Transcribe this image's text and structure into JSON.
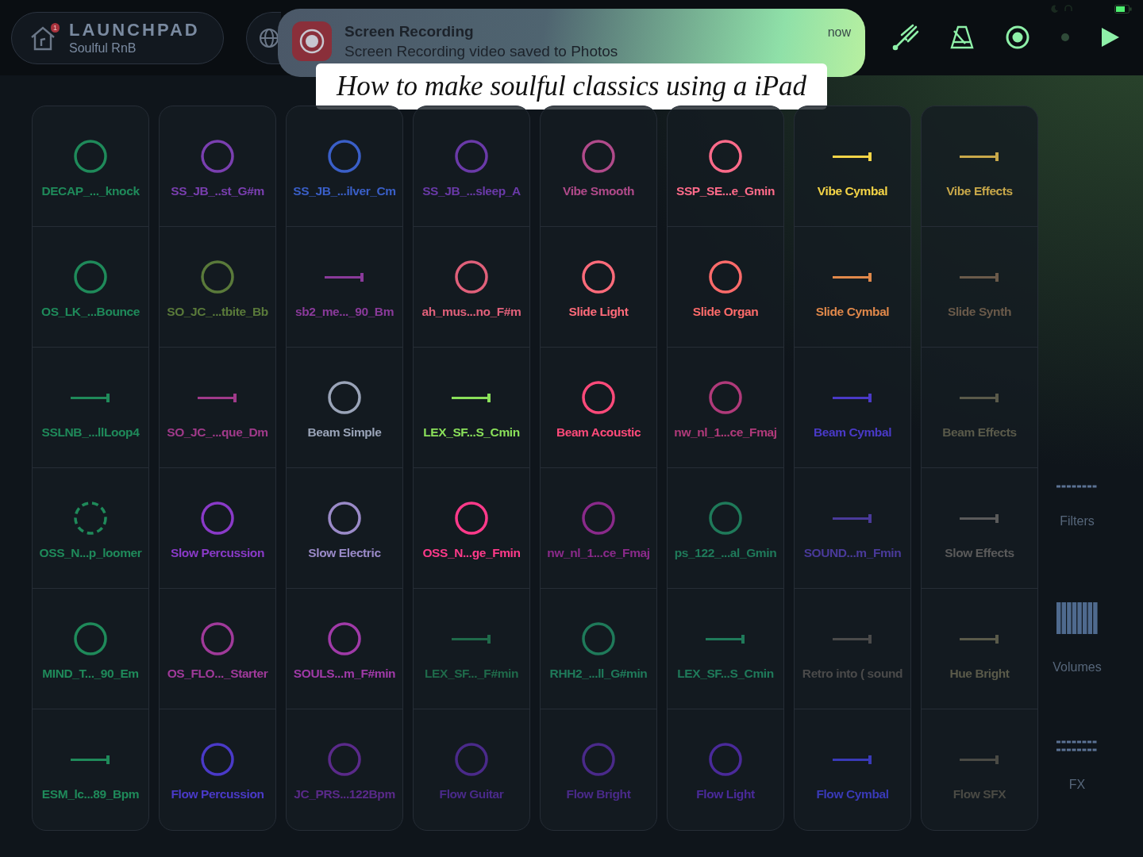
{
  "header": {
    "title": "LAUNCHPAD",
    "subtitle": "Soulful RnB",
    "badge": "1"
  },
  "notification": {
    "title": "Screen Recording",
    "body": "Screen Recording video saved to Photos",
    "time": "now"
  },
  "caption": "How to make soulful classics using a iPad",
  "pads": [
    [
      {
        "label": "DECAP_..._knock",
        "kind": "circle",
        "color": "#1f8a5a"
      },
      {
        "label": "SS_JB_..st_G#m",
        "kind": "circle",
        "color": "#7a3fb0"
      },
      {
        "label": "SS_JB_...ilver_Cm",
        "kind": "circle",
        "color": "#3a5fc8"
      },
      {
        "label": "SS_JB_...sleep_A",
        "kind": "circle",
        "color": "#6a3aa8"
      },
      {
        "label": "Vibe Smooth",
        "kind": "circle",
        "color": "#b04a8a"
      },
      {
        "label": "SSP_SE...e_Gmin",
        "kind": "circle",
        "color": "#ff6b8a"
      },
      {
        "label": "Vibe Cymbal",
        "kind": "line",
        "color": "#f5d547"
      },
      {
        "label": "Vibe Effects",
        "kind": "line",
        "color": "#c8a84a"
      }
    ],
    [
      {
        "label": "OS_LK_...Bounce",
        "kind": "circle",
        "color": "#1f8a5a"
      },
      {
        "label": "SO_JC_...tbite_Bb",
        "kind": "circle",
        "color": "#5a7a3a"
      },
      {
        "label": "sb2_me..._90_Bm",
        "kind": "line",
        "color": "#8a3a9a"
      },
      {
        "label": "ah_mus...no_F#m",
        "kind": "circle",
        "color": "#e0607a"
      },
      {
        "label": "Slide Light",
        "kind": "circle",
        "color": "#ff6b7a"
      },
      {
        "label": "Slide Organ",
        "kind": "circle",
        "color": "#ff6b6a"
      },
      {
        "label": "Slide Cymbal",
        "kind": "line",
        "color": "#e0884a"
      },
      {
        "label": "Slide Synth",
        "kind": "line",
        "color": "#6a5a4a"
      }
    ],
    [
      {
        "label": "SSLNB_...llLoop4",
        "kind": "line",
        "color": "#1f8a5a"
      },
      {
        "label": "SO_JC_...que_Dm",
        "kind": "line",
        "color": "#a03a8a"
      },
      {
        "label": "Beam Simple",
        "kind": "circle",
        "color": "#9aa4b8"
      },
      {
        "label": "LEX_SF...S_Cmin",
        "kind": "line",
        "color": "#8ae05a"
      },
      {
        "label": "Beam Acoustic",
        "kind": "circle",
        "color": "#ff4a7a"
      },
      {
        "label": "nw_nl_1...ce_Fmaj",
        "kind": "circle",
        "color": "#b03a7a"
      },
      {
        "label": "Beam Cymbal",
        "kind": "line",
        "color": "#4a3ac8"
      },
      {
        "label": "Beam Effects",
        "kind": "line",
        "color": "#5a5a4a"
      }
    ],
    [
      {
        "label": "OSS_N...p_loomer",
        "kind": "dashed",
        "color": "#1f8a5a"
      },
      {
        "label": "Slow Percussion",
        "kind": "circle",
        "color": "#8a3ac8"
      },
      {
        "label": "Slow Electric",
        "kind": "circle",
        "color": "#9a8ac8"
      },
      {
        "label": "OSS_N...ge_Fmin",
        "kind": "circle",
        "color": "#ff3a8a"
      },
      {
        "label": "nw_nl_1...ce_Fmaj",
        "kind": "circle",
        "color": "#8a2a8a"
      },
      {
        "label": "ps_122_...al_Gmin",
        "kind": "circle",
        "color": "#1f7a5a"
      },
      {
        "label": "SOUND...m_Fmin",
        "kind": "line",
        "color": "#4a3a9a"
      },
      {
        "label": "Slow Effects",
        "kind": "line",
        "color": "#5a5a5a"
      }
    ],
    [
      {
        "label": "MIND_T..._90_Em",
        "kind": "circle",
        "color": "#1f8a5a"
      },
      {
        "label": "OS_FLO..._Starter",
        "kind": "circle",
        "color": "#a03a9a"
      },
      {
        "label": "SOULS...m_F#min",
        "kind": "circle",
        "color": "#a03aa8"
      },
      {
        "label": "LEX_SF..._F#min",
        "kind": "line",
        "color": "#1f6a4a"
      },
      {
        "label": "RHH2_...ll_G#min",
        "kind": "circle",
        "color": "#1f7a5a"
      },
      {
        "label": "LEX_SF...S_Cmin",
        "kind": "line",
        "color": "#1f7a5a"
      },
      {
        "label": "Retro into ( sound",
        "kind": "line",
        "color": "#4a4a4a"
      },
      {
        "label": "Hue Bright",
        "kind": "line",
        "color": "#5a5a4a"
      }
    ],
    [
      {
        "label": "ESM_lc...89_Bpm",
        "kind": "line",
        "color": "#1f8a5a"
      },
      {
        "label": "Flow Percussion",
        "kind": "circle",
        "color": "#4a3ac8"
      },
      {
        "label": "JC_PRS...122Bpm",
        "kind": "circle",
        "color": "#5a2a8a"
      },
      {
        "label": "Flow Guitar",
        "kind": "circle",
        "color": "#4a2a8a"
      },
      {
        "label": "Flow Bright",
        "kind": "circle",
        "color": "#4a2a8a"
      },
      {
        "label": "Flow Light",
        "kind": "circle",
        "color": "#4a2a9a"
      },
      {
        "label": "Flow Cymbal",
        "kind": "line",
        "color": "#3a3ab8"
      },
      {
        "label": "Flow SFX",
        "kind": "line",
        "color": "#4a4a44"
      }
    ]
  ],
  "side_panel": [
    {
      "label": "Filters",
      "kind": "filters"
    },
    {
      "label": "Volumes",
      "kind": "volumes"
    },
    {
      "label": "FX",
      "kind": "fx"
    }
  ]
}
